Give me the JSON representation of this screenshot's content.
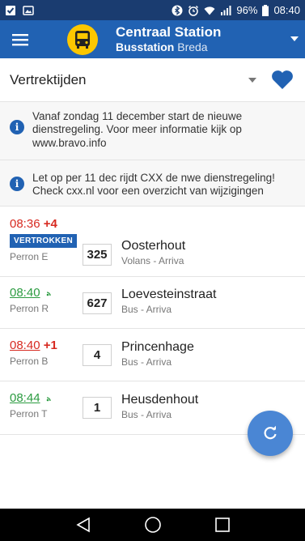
{
  "status_bar": {
    "battery": "96%",
    "time": "08:40",
    "icons": [
      "checkbox-icon",
      "photo-icon",
      "bluetooth-icon",
      "alarm-icon",
      "wifi-icon",
      "signal-icon",
      "battery-icon"
    ]
  },
  "app_bar": {
    "title": "Centraal Station",
    "subtitle_strong": "Busstation",
    "subtitle_light": "Breda",
    "colors": {
      "background": "#2162b3",
      "badge": "#fcc700"
    }
  },
  "toolbar": {
    "label": "Vertrektijden",
    "favorite_color": "#2162b3"
  },
  "notices": [
    {
      "text": "Vanaf zondag 11 december start de nieuwe dienstregeling. Voor meer informatie kijk op www.bravo.info"
    },
    {
      "text": "Let op per 11 dec rijdt CXX de nwe dienstregeling! Check cxx.nl voor een overzicht van wijzigingen"
    }
  ],
  "departures": [
    {
      "time": "08:36",
      "delay": "+4",
      "status": "VERTROKKEN",
      "platform": "Perron E",
      "line": "325",
      "destination": "Oosterhout",
      "operator": "Volans - Arriva",
      "time_color": "#d72a21"
    },
    {
      "time": "08:40",
      "delay": "",
      "platform": "Perron R",
      "line": "627",
      "destination": "Loevesteinstraat",
      "operator": "Bus - Arriva",
      "time_color": "#2b9b40"
    },
    {
      "time": "08:40",
      "delay": "+1",
      "platform": "Perron B",
      "line": "4",
      "destination": "Princenhage",
      "operator": "Bus - Arriva",
      "time_color": "#d72a21"
    },
    {
      "time": "08:44",
      "delay": "",
      "platform": "Perron T",
      "line": "1",
      "destination": "Heusdenhout",
      "operator": "Bus - Arriva",
      "time_color": "#2b9b40"
    }
  ]
}
